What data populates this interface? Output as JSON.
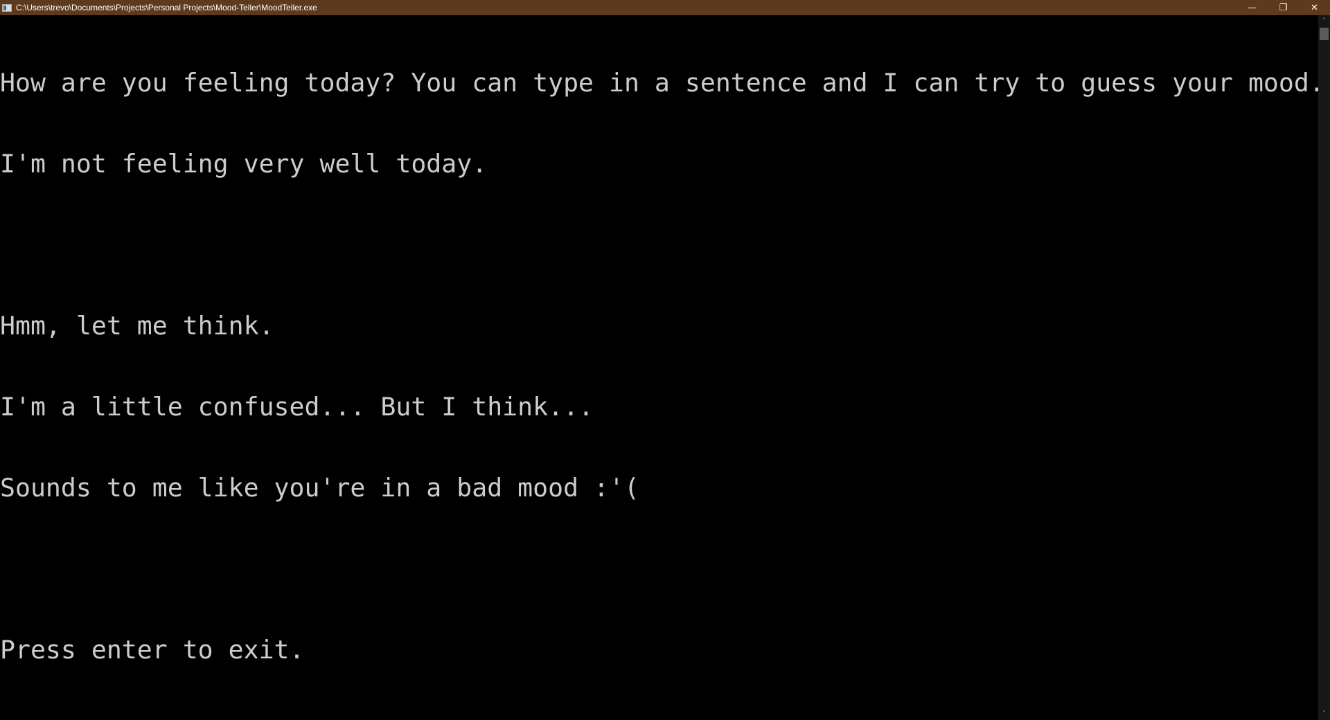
{
  "window": {
    "title": "C:\\Users\\trevo\\Documents\\Projects\\Personal Projects\\Mood-Teller\\MoodTeller.exe",
    "icon": "console-app-icon",
    "controls": {
      "minimize": "—",
      "restore": "❐",
      "close": "✕"
    },
    "titlebar_color": "#5d3a1e"
  },
  "console": {
    "text_color": "#cccccc",
    "background": "#000000",
    "lines": [
      "How are you feeling today? You can type in a sentence and I can try to guess your mood.",
      "I'm not feeling very well today.",
      "",
      "Hmm, let me think.",
      "I'm a little confused... But I think...",
      "Sounds to me like you're in a bad mood :'(",
      "",
      "Press enter to exit."
    ]
  },
  "scrollbar": {
    "up": "˄",
    "down": "˅"
  }
}
